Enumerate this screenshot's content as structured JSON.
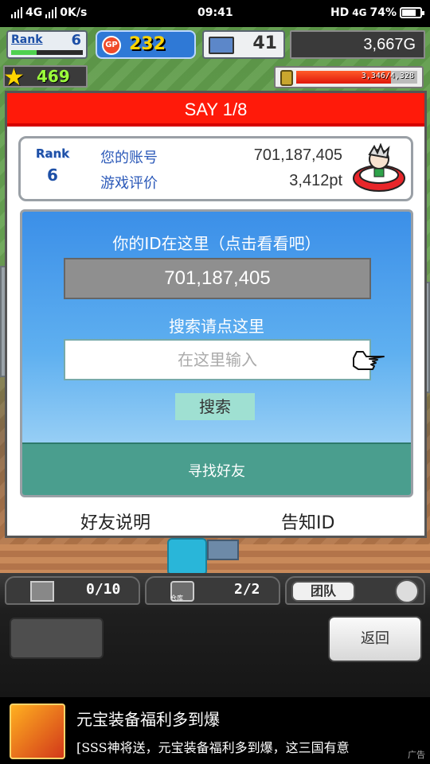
{
  "status_bar": {
    "network": "4G",
    "speed": "0K/s",
    "time": "09:41",
    "hd": "HD",
    "network2": "4G",
    "battery": "74%"
  },
  "hud": {
    "rank_label": "Rank",
    "rank_value": "6",
    "gp_icon_text": "GP",
    "gp_value": "232",
    "pc_value": "41",
    "money": "3,667G",
    "stars": "469",
    "energy": "3,346/4,328"
  },
  "dialog": {
    "title": "SAY 1/8",
    "rank_label": "Rank",
    "rank_value": "6",
    "account_label": "您的账号",
    "account_value": "701,187,405",
    "rating_label": "游戏评价",
    "rating_value": "3,412pt",
    "id_prompt": "你的ID在这里（点击看看吧）",
    "id_value": "701,187,405",
    "search_prompt": "搜索请点这里",
    "search_placeholder": "在这里输入",
    "search_button": "搜索",
    "find_friends": "寻找好友",
    "friends_help": "好友说明",
    "notify_id": "告知ID"
  },
  "toolbar": {
    "tab1_count": "0/10",
    "tab2_label": "仓库",
    "tab2_count": "2/2",
    "team_label": "团队",
    "back_button": "返回"
  },
  "ad": {
    "title": "元宝装备福利多到爆",
    "description": "[SSS神将送，元宝装备福利多到爆，这三国有意",
    "tag": "广告"
  }
}
